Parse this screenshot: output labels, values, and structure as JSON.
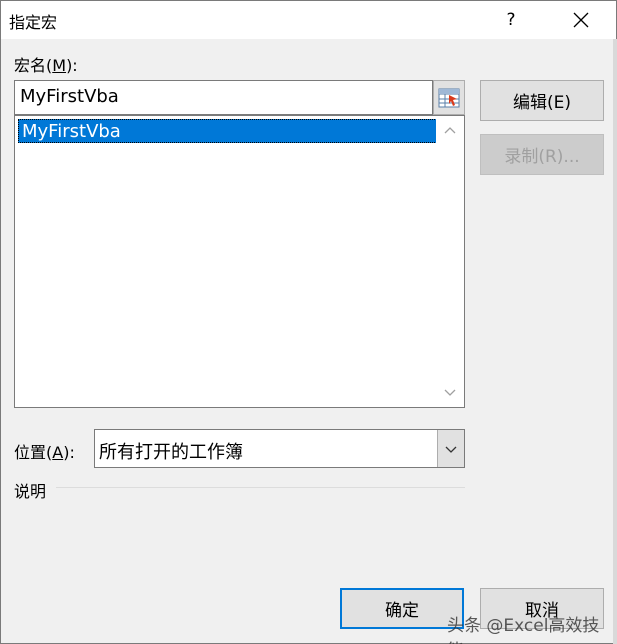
{
  "dialog": {
    "title": "指定宏",
    "help_label": "?",
    "close_icon": "close-icon"
  },
  "macro_name": {
    "label_prefix": "宏名(",
    "label_key": "M",
    "label_suffix": "):",
    "value": "MyFirstVba",
    "ref_icon": "collapse-dialog-icon"
  },
  "macro_list": {
    "items": [
      "MyFirstVba"
    ],
    "selected_index": 0
  },
  "buttons": {
    "edit": "编辑(E)",
    "record": "录制(R)...",
    "ok": "确定",
    "cancel": "取消"
  },
  "location": {
    "label_prefix": "位置(",
    "label_key": "A",
    "label_suffix": "):",
    "selected": "所有打开的工作簿"
  },
  "description": {
    "label": "说明"
  },
  "watermark": "头条 @Excel高效技能",
  "colors": {
    "selection": "#0078d7",
    "default_button_border": "#0078d7"
  }
}
